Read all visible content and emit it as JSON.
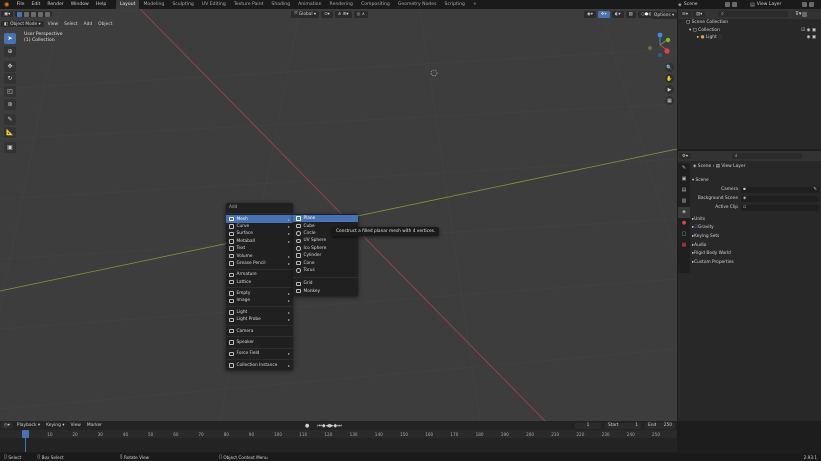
{
  "topbar": {
    "menus": [
      "File",
      "Edit",
      "Render",
      "Window",
      "Help"
    ],
    "workspaces": [
      "Layout",
      "Modeling",
      "Sculpting",
      "UV Editing",
      "Texture Paint",
      "Shading",
      "Animation",
      "Rendering",
      "Compositing",
      "Geometry Nodes",
      "Scripting"
    ],
    "active_workspace": "Layout",
    "scene": "Scene",
    "view_layer": "View Layer"
  },
  "viewport": {
    "mode": "Object Mode",
    "menus": [
      "View",
      "Select",
      "Add",
      "Object"
    ],
    "transform_orientation": "Global",
    "options_label": "Options",
    "perspective_label": "User Perspective",
    "collection_label": "(1) Collection"
  },
  "add_menu": {
    "title": "Add",
    "items": [
      {
        "label": "Mesh",
        "icon": "mesh-icon",
        "submenu": true,
        "active": true
      },
      {
        "label": "Curve",
        "icon": "curve-icon",
        "submenu": true
      },
      {
        "label": "Surface",
        "icon": "surface-icon",
        "submenu": true
      },
      {
        "label": "Metaball",
        "icon": "metaball-icon",
        "submenu": true
      },
      {
        "label": "Text",
        "icon": "text-icon",
        "submenu": false
      },
      {
        "label": "Volume",
        "icon": "volume-icon",
        "submenu": true
      },
      {
        "label": "Grease Pencil",
        "icon": "grease-pencil-icon",
        "submenu": true
      },
      {
        "sep": true
      },
      {
        "label": "Armature",
        "icon": "armature-icon",
        "submenu": false
      },
      {
        "label": "Lattice",
        "icon": "lattice-icon",
        "submenu": false
      },
      {
        "sep": true
      },
      {
        "label": "Empty",
        "icon": "empty-icon",
        "submenu": true
      },
      {
        "label": "Image",
        "icon": "image-icon",
        "submenu": true
      },
      {
        "sep": true
      },
      {
        "label": "Light",
        "icon": "light-icon",
        "submenu": true
      },
      {
        "label": "Light Probe",
        "icon": "light-probe-icon",
        "submenu": true
      },
      {
        "sep": true
      },
      {
        "label": "Camera",
        "icon": "camera-icon",
        "submenu": false
      },
      {
        "sep": true
      },
      {
        "label": "Speaker",
        "icon": "speaker-icon",
        "submenu": false
      },
      {
        "sep": true
      },
      {
        "label": "Force Field",
        "icon": "force-field-icon",
        "submenu": true
      },
      {
        "sep": true
      },
      {
        "label": "Collection Instance",
        "icon": "collection-icon",
        "submenu": true
      }
    ]
  },
  "mesh_menu": {
    "items": [
      {
        "label": "Plane",
        "active": true
      },
      {
        "label": "Cube"
      },
      {
        "label": "Circle"
      },
      {
        "label": "UV Sphere"
      },
      {
        "label": "Ico Sphere"
      },
      {
        "label": "Cylinder"
      },
      {
        "label": "Cone"
      },
      {
        "label": "Torus"
      },
      {
        "sep": true
      },
      {
        "label": "Grid"
      },
      {
        "label": "Monkey"
      }
    ]
  },
  "tooltip": "Construct a filled planar mesh with 4 vertices.",
  "outliner": {
    "root": "Scene Collection",
    "collection": "Collection",
    "light": "Light"
  },
  "properties": {
    "breadcrumb_scene": "Scene",
    "breadcrumb_layer": "View Layer",
    "section": "Scene",
    "fields": [
      {
        "label": "Camera"
      },
      {
        "label": "Background Scene"
      },
      {
        "label": "Active Clip"
      }
    ],
    "panels": [
      "Units",
      "Gravity",
      "Keying Sets",
      "Audio",
      "Rigid Body World",
      "Custom Properties"
    ],
    "gravity_checked": true
  },
  "timeline": {
    "menus": [
      "Playback",
      "Keying",
      "View",
      "Marker"
    ],
    "current_frame": "1",
    "start_label": "Start",
    "start_value": "1",
    "end_label": "End",
    "end_value": "250",
    "ticks": [
      "0",
      "10",
      "20",
      "30",
      "40",
      "50",
      "60",
      "70",
      "80",
      "90",
      "100",
      "110",
      "120",
      "130",
      "140",
      "150",
      "160",
      "170",
      "180",
      "190",
      "200",
      "210",
      "220",
      "230",
      "240",
      "250"
    ]
  },
  "statusbar": {
    "select": "Select",
    "box_select": "Box Select",
    "rotate_view": "Rotate View",
    "object_ctx": "Object Context Menu",
    "version": "2.93.1"
  },
  "colors": {
    "accent": "#4772b3",
    "x_axis": "#d04a4a",
    "y_axis": "#8cb43c",
    "light_icon": "#e8a640"
  }
}
